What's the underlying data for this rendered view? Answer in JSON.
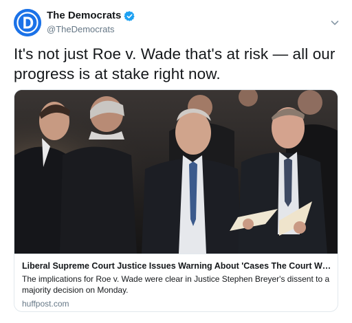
{
  "account": {
    "name": "The Democrats",
    "handle": "@TheDemocrats",
    "verified": true,
    "brand_color": "#1b72e8"
  },
  "tweet": {
    "text": "It's not just Roe v. Wade that's at risk — all our progress is at stake right now."
  },
  "card": {
    "title": "Liberal Supreme Court Justice Issues Warning About 'Cases The Court Will O...",
    "description": "The implications for Roe v. Wade were clear in Justice Stephen Breyer's dissent to a majority decision on Monday.",
    "domain": "huffpost.com"
  },
  "icons": {
    "avatar": "democrats-d-logo",
    "verified": "verified-badge-icon",
    "menu": "chevron-down-icon"
  },
  "colors": {
    "verified_blue": "#1da1f2",
    "secondary_text": "#657786",
    "border": "#e1e8ed"
  }
}
